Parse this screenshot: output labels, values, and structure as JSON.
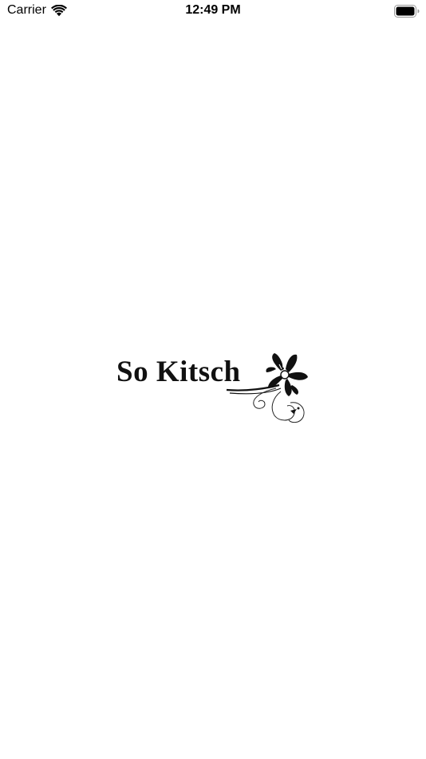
{
  "status_bar": {
    "carrier": "Carrier",
    "time": "12:49 PM",
    "wifi_icon": "wifi-icon",
    "battery_icon": "battery-icon"
  },
  "splash": {
    "logo_text": "So Kitsch",
    "logo_icon": "flower-swirl-icon",
    "background_color": "#ffffff",
    "text_color": "#111111"
  }
}
